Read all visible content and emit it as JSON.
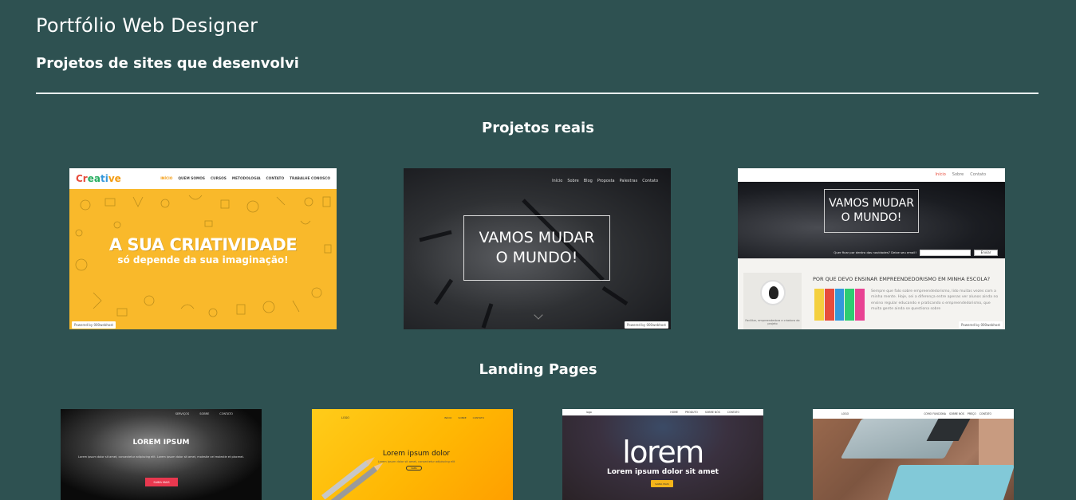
{
  "header": {
    "title": "Portfólio Web Designer",
    "subtitle": "Projetos de sites que desenvolvi"
  },
  "sections": {
    "real_projects": "Projetos reais",
    "landing_pages": "Landing Pages"
  },
  "projects": [
    {
      "logo": "Creative",
      "nav": [
        "INÍCIO",
        "QUEM SOMOS",
        "CURSOS",
        "METODOLOGIA",
        "CONTATO",
        "TRABALHE CONOSCO"
      ],
      "headline": "A SUA CRIATIVIDADE",
      "tagline": "só depende da sua imaginação!",
      "powered": "Powered by 000webhost"
    },
    {
      "nav": [
        "Início",
        "Sobre",
        "Blog",
        "Proposta",
        "Palestras",
        "Contato"
      ],
      "box_line1": "VAMOS MUDAR",
      "box_line2": "O MUNDO!",
      "powered": "Powered by 000webhost"
    },
    {
      "nav": [
        "Início",
        "Sobre",
        "Contato"
      ],
      "box_line1": "VAMOS MUDAR",
      "box_line2": "O MUNDO!",
      "bar_text": "Quer ficar por dentro das novidades? Deixe seu email!",
      "bar_button": "Enviar",
      "aside_text": "Facilitar, empreendedora e criadora do projeto",
      "article_title": "POR QUE DEVO ENSINAR EMPREENDEDORISMO EM MINHA ESCOLA?",
      "article_text": "Sempre que falo sobre empreendedorismo, lido muitas vezes com a minha mente. Hoje, sei a diferença entre apenas ver alunos ainda no ensino regular educando e praticando o empreendedorismo, que muita gente ainda se questiona sobre",
      "powered": "Powered by 000webhost"
    }
  ],
  "landing_pages": [
    {
      "nav": [
        "SERVIÇOS",
        "SOBRE",
        "CONTATO"
      ],
      "title": "LOREM IPSUM",
      "text": "Lorem ipsum dolor sit amet, consectetur adipiscing elit. Lorem ipsum dolor sit amet, molestie vel molestie et placerat.",
      "button": "SAIBA MAIS"
    },
    {
      "logo": "LOGO",
      "nav": [
        "INÍCIO",
        "SOBRE",
        "CONTATO"
      ],
      "title": "Lorem ipsum dolor",
      "text": "Lorem ipsum dolor sit amet, consectetur adipiscing elit",
      "button": "SAIBA"
    },
    {
      "logo": "logo",
      "nav": [
        "HOME",
        "PRODUTO",
        "SOBRE NÓS",
        "CONTATO"
      ],
      "title": "lorem",
      "subtitle": "Lorem ipsum dolor sit amet",
      "button": "SAIBA MAIS"
    },
    {
      "logo": "LOGO",
      "nav": [
        "COMO FUNCIONA",
        "SOBRE NÓS",
        "PREÇO",
        "CONTATO"
      ]
    }
  ],
  "colors": {
    "background": "#2e5151",
    "text": "#ffffff",
    "divider": "#e8eeee"
  }
}
